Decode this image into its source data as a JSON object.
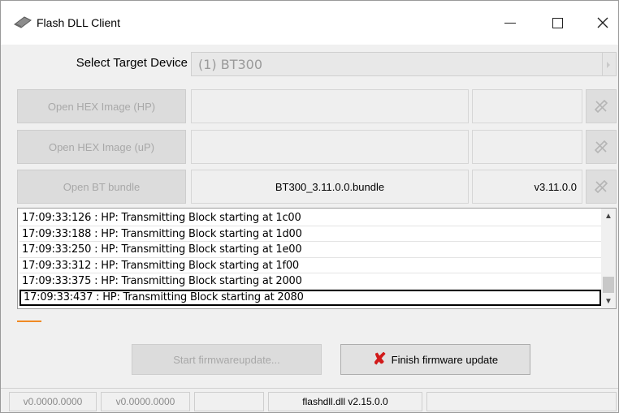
{
  "window": {
    "title": "Flash DLL Client",
    "icon": "flash-drive-icon",
    "controls": {
      "minimize": "minimize-icon",
      "maximize": "maximize-icon",
      "close": "close-icon"
    }
  },
  "target": {
    "label": "Select Target Device",
    "value": "(1) BT300"
  },
  "rows": [
    {
      "button": "Open HEX Image (HP)",
      "path": "",
      "version": ""
    },
    {
      "button": "Open HEX Image (uP)",
      "path": "",
      "version": ""
    },
    {
      "button": "Open BT bundle",
      "path": "BT300_3.11.0.0.bundle",
      "version": "v3.11.0.0"
    }
  ],
  "log": [
    "17:09:33:126 : HP: Transmitting Block starting at 1c00",
    "17:09:33:188 : HP: Transmitting Block starting at 1d00",
    "17:09:33:250 : HP: Transmitting Block starting at 1e00",
    "17:09:33:312 : HP: Transmitting Block starting at 1f00",
    "17:09:33:375 : HP: Transmitting Block starting at 2000",
    "17:09:33:437 : HP: Transmitting Block starting at 2080"
  ],
  "progress": {
    "fraction": 0.04,
    "color": "#f08a24"
  },
  "buttons": {
    "start": "Start firmwareupdate...",
    "finish": "Finish firmware update"
  },
  "status": {
    "cell1": "v0.0000.0000",
    "cell2": "v0.0000.0000",
    "cell3": "",
    "cell4": "flashdll.dll v2.15.0.0",
    "cell5": ""
  },
  "colors": {
    "accent": "#f08a24",
    "error": "#d11a1a"
  }
}
